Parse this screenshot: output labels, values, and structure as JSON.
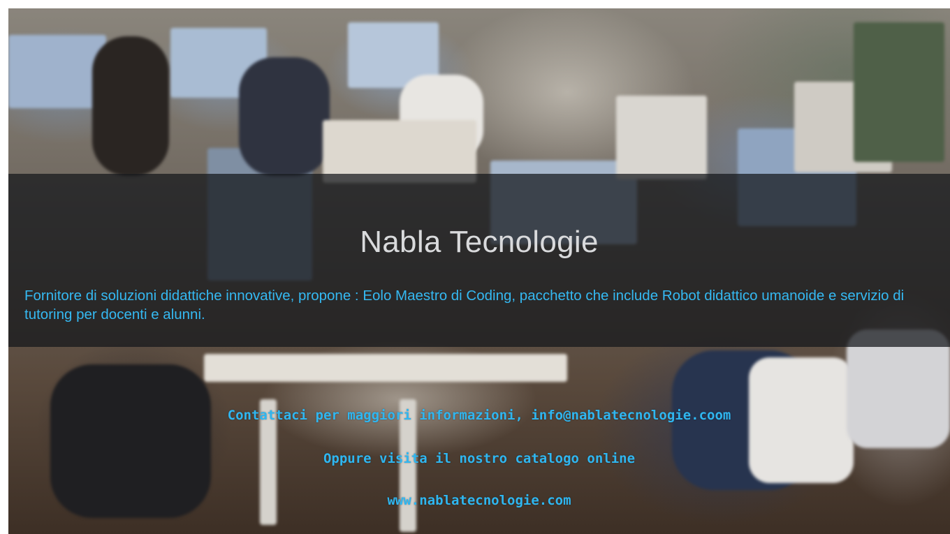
{
  "slide": {
    "title": "Nabla Tecnologie",
    "description": "Fornitore di soluzioni didattiche innovative, propone : Eolo Maestro di Coding, pacchetto che include Robot didattico  umanoide e servizio di tutoring per docenti e alunni.",
    "contact_line": "Contattaci per maggiori informazioni, info@nablatecnologie.coom",
    "catalog_line": "Oppure visita il nostro catalogo online",
    "website": "www.nablatecnologie.com"
  },
  "colors": {
    "title": "#d9dadc",
    "accent": "#35b9f2",
    "band": "#14161a"
  }
}
